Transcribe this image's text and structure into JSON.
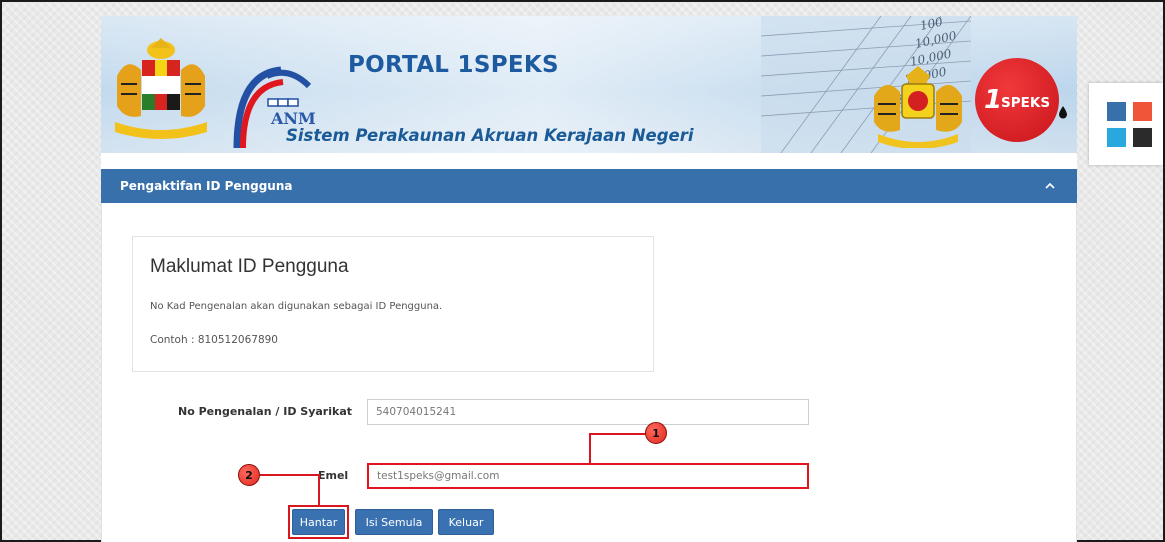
{
  "header": {
    "portal_title": "PORTAL 1SPEKS",
    "anm_text": "ANM",
    "subtitle": "Sistem Perakaunan Akruan Kerajaan Negeri",
    "badge_one": "1",
    "badge_speks": "SPEKS"
  },
  "theme": {
    "header_bar": "#3870ab",
    "button": "#3a71b0",
    "callout": "#d8161d",
    "swatches": [
      "#3870ab",
      "#f0553a",
      "#29a8e0",
      "#2b2b2b"
    ]
  },
  "panel": {
    "title": "Pengaktifan ID Pengguna",
    "collapse_icon": "chevron-up-icon"
  },
  "info": {
    "title": "Maklumat ID Pengguna",
    "line1": "No Kad Pengenalan akan digunakan sebagai ID Pengguna.",
    "line2": "Contoh : 810512067890"
  },
  "form": {
    "id_label": "No Pengenalan / ID Syarikat",
    "id_value": "540704015241",
    "email_label": "Emel",
    "email_value": "test1speks@gmail.com"
  },
  "buttons": {
    "submit": "Hantar",
    "reset": "Isi Semula",
    "exit": "Keluar"
  },
  "callouts": {
    "one": "1",
    "two": "2"
  }
}
